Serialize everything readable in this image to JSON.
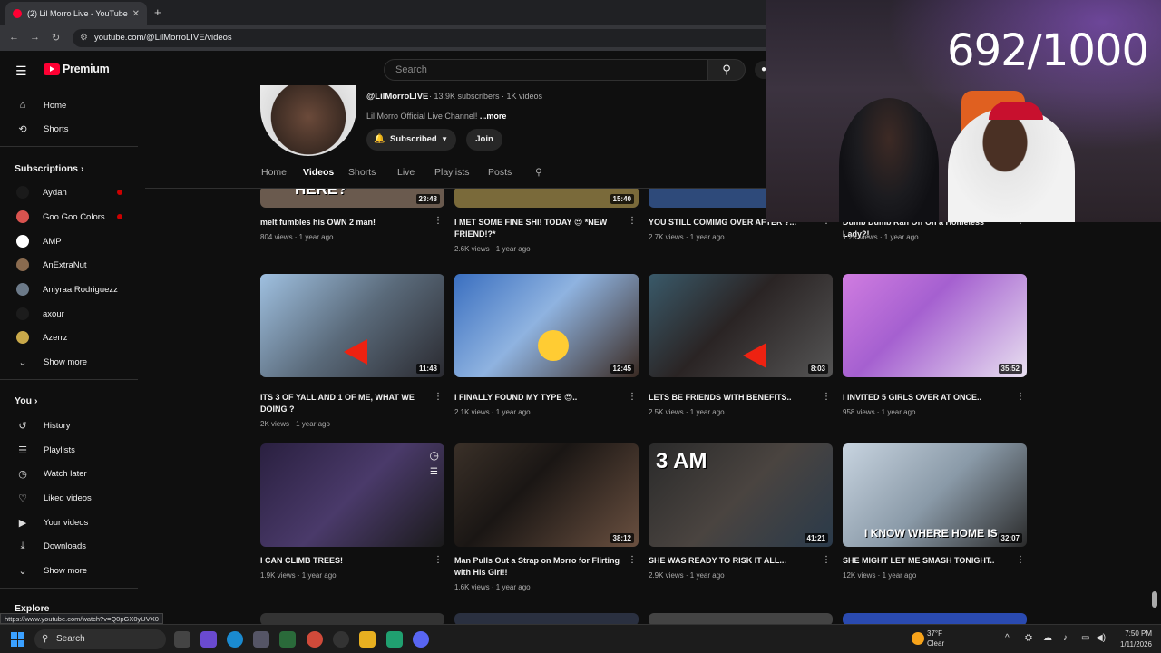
{
  "browser": {
    "tab_title": "(2) Lil Morro Live - YouTube",
    "tab_close": "✕",
    "new_tab": "+",
    "url": "youtube.com/@LilMorroLIVE/videos",
    "status_url": "https://www.youtube.com/watch?v=Q0pGX0yUVX0"
  },
  "youtube": {
    "logo_text": "Premium",
    "search_placeholder": "Search",
    "sidebar": {
      "main": [
        {
          "label": "Home",
          "icon": "home-icon",
          "glyph": "⌂"
        },
        {
          "label": "Shorts",
          "icon": "shorts-icon",
          "glyph": "⟲"
        }
      ],
      "subscriptions_header": "Subscriptions",
      "subscriptions": [
        {
          "label": "Aydan",
          "color": "#1a1a1a",
          "live": true
        },
        {
          "label": "Goo Goo Colors",
          "color": "#d9534f",
          "live": true
        },
        {
          "label": "AMP",
          "color": "#ffffff",
          "live": false
        },
        {
          "label": "AnExtraNut",
          "color": "#8a6b4f",
          "live": false
        },
        {
          "label": "Aniyraa Rodriguezz",
          "color": "#6c7a89",
          "live": false
        },
        {
          "label": "axour",
          "color": "#1c1c1c",
          "live": false
        },
        {
          "label": "Azerrz",
          "color": "#c9a94a",
          "live": false
        }
      ],
      "show_more_1": "Show more",
      "you_header": "You",
      "you": [
        {
          "label": "History",
          "icon": "history-icon",
          "glyph": "↺"
        },
        {
          "label": "Playlists",
          "icon": "playlists-icon",
          "glyph": "☰"
        },
        {
          "label": "Watch later",
          "icon": "watch-later-icon",
          "glyph": "◷"
        },
        {
          "label": "Liked videos",
          "icon": "like-icon",
          "glyph": "👍"
        },
        {
          "label": "Your videos",
          "icon": "your-videos-icon",
          "glyph": "▶"
        },
        {
          "label": "Downloads",
          "icon": "download-icon",
          "glyph": "⤓"
        }
      ],
      "show_more_2": "Show more",
      "explore_header": "Explore"
    },
    "channel": {
      "handle": "@LilMorroLIVE",
      "meta": "· 13.9K subscribers · 1K videos",
      "description": "Lil Morro Official Live Channel!",
      "more": "...more",
      "subscribed_label": "Subscribed",
      "join_label": "Join",
      "tabs": [
        "Home",
        "Videos",
        "Shorts",
        "Live",
        "Playlists",
        "Posts"
      ],
      "active_tab": "Videos"
    },
    "videos": [
      {
        "title": "melt fumbles his OWN 2 man!",
        "meta": "804 views · 1 year ago",
        "duration": "23:48",
        "thumb": "#6a5a4e",
        "overlay": "HERE?"
      },
      {
        "title": "I MET SOME FINE SHI! TODAY 😍 *NEW FRIEND!?*",
        "meta": "2.6K views · 1 year ago",
        "duration": "15:40",
        "thumb": "#7a6a3a",
        "overlay": ""
      },
      {
        "title": "YOU STILL COMIMG OVER AFTER ?...",
        "meta": "2.7K views · 1 year ago",
        "duration": "",
        "thumb": "#2e4a7a",
        "overlay": ""
      },
      {
        "title": "Dumb Dumb Ran Off On a Homeless Lady?!",
        "meta": "1.2K views · 1 year ago",
        "duration": "",
        "thumb": "#444",
        "overlay": ""
      },
      {
        "title": "ITS 3 OF YALL AND 1 OF ME, WHAT WE DOING ?",
        "meta": "2K views · 1 year ago",
        "duration": "11:48",
        "thumb": "#8aa7c7",
        "overlay": ""
      },
      {
        "title": "I FINALLY FOUND MY TYPE 😍..",
        "meta": "2.1K views · 1 year ago",
        "duration": "12:45",
        "thumb": "#5b7fb5",
        "overlay": ""
      },
      {
        "title": "LETS BE FRIENDS WITH BENEFITS..",
        "meta": "2.5K views · 1 year ago",
        "duration": "8:03",
        "thumb": "#3d3a3a",
        "overlay": ""
      },
      {
        "title": "I INVITED 5 GIRLS OVER AT ONCE..",
        "meta": "958 views · 1 year ago",
        "duration": "35:52",
        "thumb": "#b36ad4",
        "overlay": ""
      },
      {
        "title": "I CAN CLIMB TREES!",
        "meta": "1.9K views · 1 year ago",
        "duration": "",
        "thumb": "#3a2f4a",
        "overlay": ""
      },
      {
        "title": "Man Pulls Out a Strap on Morro for Flirting with His Girl!!",
        "meta": "1.6K views · 1 year ago",
        "duration": "38:12",
        "thumb": "#2a2420",
        "overlay": ""
      },
      {
        "title": "SHE WAS READY TO RISK IT ALL...",
        "meta": "2.9K views · 1 year ago",
        "duration": "41:21",
        "thumb": "#3a3430",
        "overlay": "3 AM"
      },
      {
        "title": "SHE MIGHT LET ME SMASH TONIGHT..",
        "meta": "12K views · 1 year ago",
        "duration": "32:07",
        "thumb": "#9aa6b2",
        "overlay": "I KNOW WHERE HOME IS"
      }
    ]
  },
  "stream": {
    "counter": "692/1000"
  },
  "taskbar": {
    "search_label": "Search",
    "temp": "37°F",
    "condition": "Clear",
    "time": "7:50 PM",
    "date": "1/11/2026"
  }
}
